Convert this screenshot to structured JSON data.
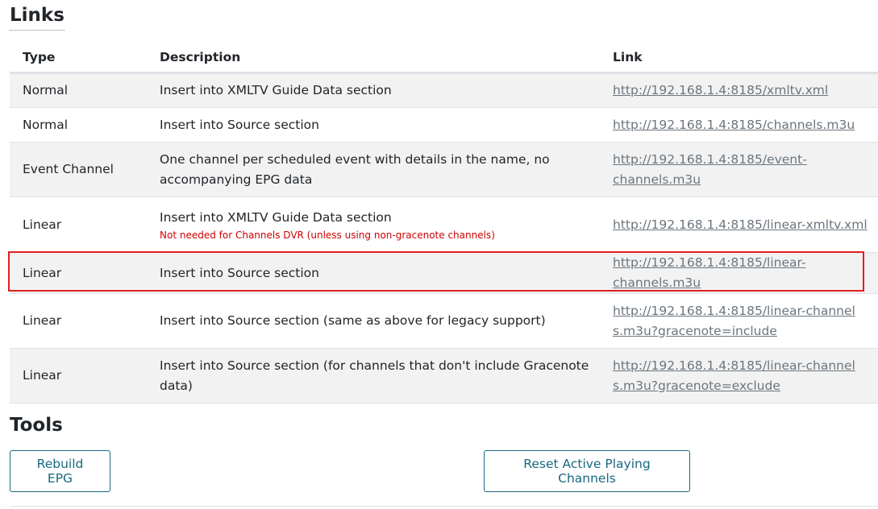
{
  "links_section": {
    "title": "Links"
  },
  "table": {
    "headers": {
      "type": "Type",
      "description": "Description",
      "link": "Link"
    },
    "rows": [
      {
        "type": "Normal",
        "description": "Insert into XMLTV Guide Data section",
        "note": "",
        "link": "http://192.168.1.4:8185/xmltv.xml"
      },
      {
        "type": "Normal",
        "description": "Insert into Source section",
        "note": "",
        "link": "http://192.168.1.4:8185/channels.m3u"
      },
      {
        "type": "Event Channel",
        "description": "One channel per scheduled event with details in the name, no accompanying EPG data",
        "note": "",
        "link": "http://192.168.1.4:8185/event-channels.m3u"
      },
      {
        "type": "Linear",
        "description": "Insert into XMLTV Guide Data section",
        "note": "Not needed for Channels DVR (unless using non-gracenote channels)",
        "link": "http://192.168.1.4:8185/linear-xmltv.xml"
      },
      {
        "type": "Linear",
        "description": "Insert into Source section",
        "note": "",
        "link": "http://192.168.1.4:8185/linear-channels.m3u",
        "highlighted": true
      },
      {
        "type": "Linear",
        "description": "Insert into Source section (same as above for legacy support)",
        "note": "",
        "link": "http://192.168.1.4:8185/linear-channels.m3u?gracenote=include"
      },
      {
        "type": "Linear",
        "description": "Insert into Source section (for channels that don't include Gracenote data)",
        "note": "",
        "link": "http://192.168.1.4:8185/linear-channels.m3u?gracenote=exclude"
      }
    ]
  },
  "tools_section": {
    "title": "Tools",
    "rebuild_label": "Rebuild EPG",
    "reset_label": "Reset Active Playing Channels"
  },
  "colors": {
    "link": "#6c757d",
    "note": "#d00000",
    "highlight": "#e02020",
    "button": "#17687e"
  }
}
